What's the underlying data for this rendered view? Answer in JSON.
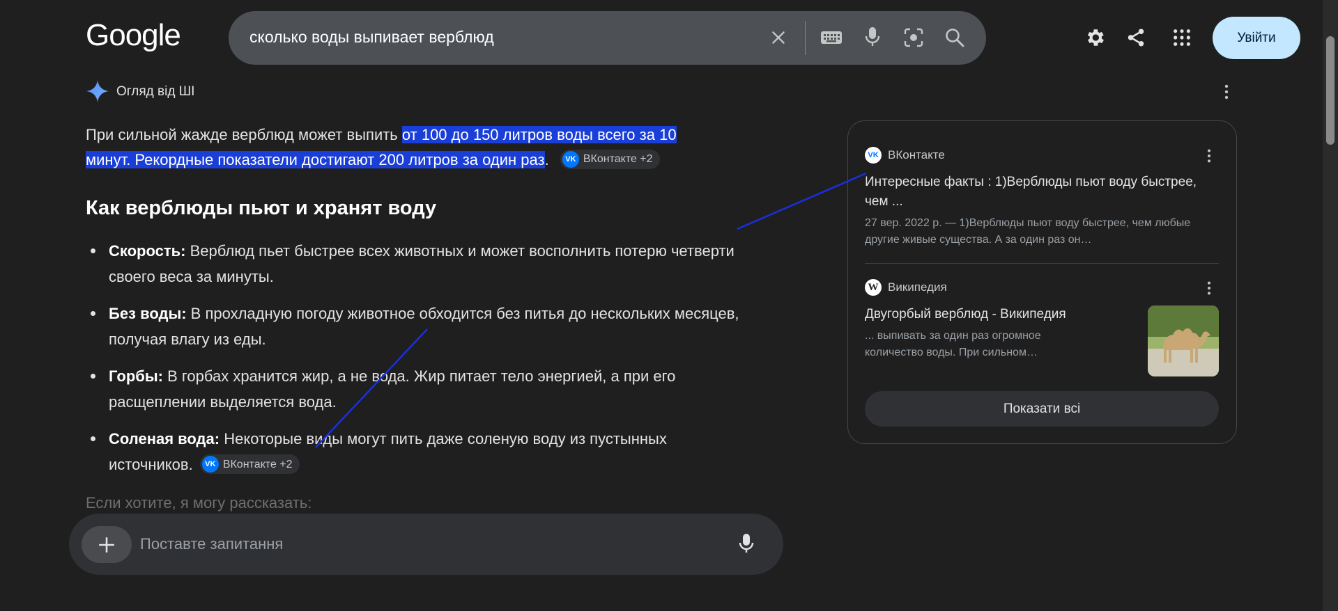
{
  "header": {
    "logo": "Google",
    "query": "сколько воды выпивает верблюд",
    "signin_label": "Увійти"
  },
  "ai_overview": {
    "label": "Огляд від ШІ",
    "intro_plain": "При сильной жажде верблюд может выпить ",
    "intro_highlight_1": "от 100 до 150 литров воды всего за 10",
    "intro_highlight_2": "минут. Рекордные показатели достигают 200 литров за один раз",
    "intro_end": ".",
    "chip_label": "ВКонтакте +2",
    "heading": "Как верблюды пьют и хранят воду",
    "bullets": [
      {
        "term": "Скорость:",
        "text": " Верблюд пьет быстрее всех животных и может восполнить потерю четверти своего веса за минуты."
      },
      {
        "term": "Без воды:",
        "text": " В прохладную погоду животное обходится без питья до нескольких месяцев, получая влагу из еды."
      },
      {
        "term": "Горбы:",
        "text": " В горбах хранится жир, а не вода. Жир питает тело энергией, а при его расщеплении выделяется вода."
      },
      {
        "term": "Соленая вода:",
        "text": " Некоторые виды могут пить даже соленую воду из пустынных источников.",
        "chip": "ВКонтакте +2"
      }
    ],
    "faded_text": "Если хотите, я могу рассказать:"
  },
  "ask_bar": {
    "placeholder": "Поставте запитання"
  },
  "sources": [
    {
      "site": "ВКонтакте",
      "title": "Интересные факты : 1)Верблюды пьют воду быстрее, чем ...",
      "snippet": "27 вер. 2022 р. — 1)Верблюды пьют воду быстрее, чем любые другие живые существа. А за один раз он…"
    },
    {
      "site": "Википедия",
      "title": "Двугорбый верблюд - Википедия",
      "snippet": "... выпивать за один раз огромное количество воды. При сильном…"
    }
  ],
  "show_all_label": "Показати всі",
  "colors": {
    "background": "#1f1f1f",
    "highlight": "#1a3ed8",
    "signin_bg": "#c2e7ff",
    "annotation_line": "#1a2fe0"
  }
}
